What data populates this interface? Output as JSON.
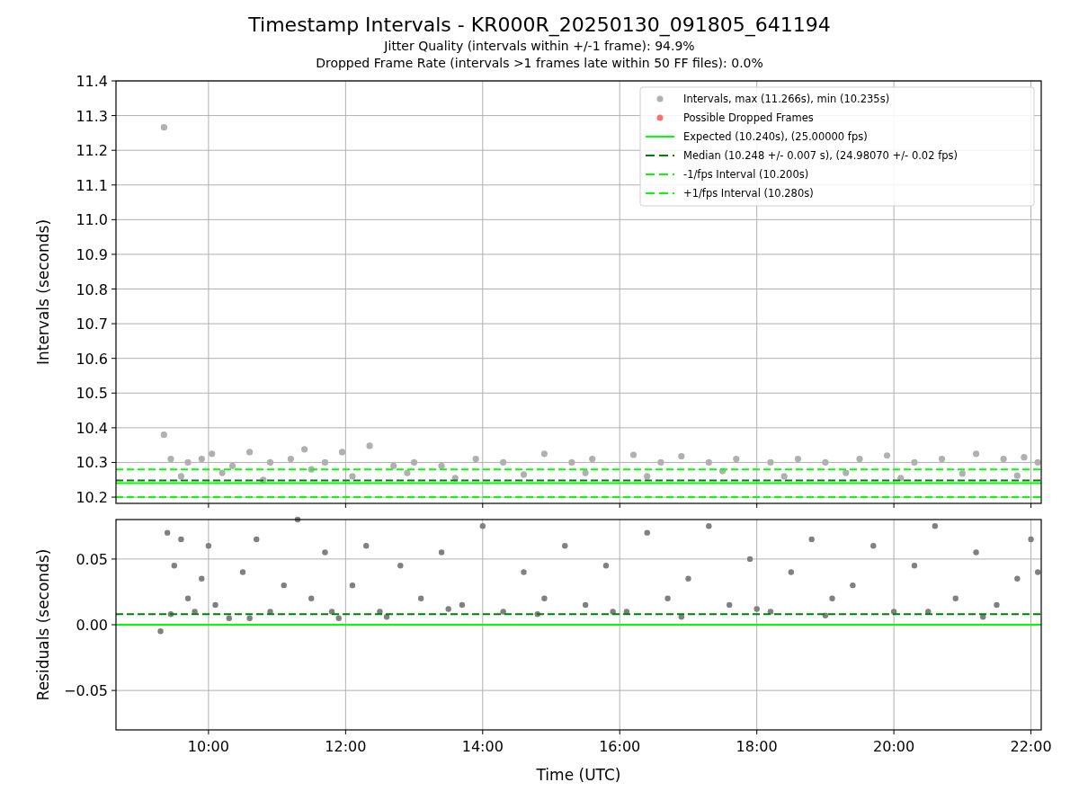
{
  "figure": {
    "title": "Timestamp Intervals - KR000R_20250130_091805_641194",
    "subtitles": [
      "Jitter Quality (intervals within +/-1 frame): 94.9%",
      "Dropped Frame Rate (intervals >1 frames late within 50 FF files): 0.0%"
    ]
  },
  "panels": [
    {
      "chart_data": {
        "type": "scatter",
        "legend": "upper right",
        "ylabel": "Intervals (seconds)",
        "xlim": [
          8.65,
          22.15
        ],
        "ylim": [
          10.182,
          11.4
        ],
        "yticks": [
          {
            "value": 10.2,
            "label": "10.2"
          },
          {
            "value": 10.3,
            "label": "10.3"
          },
          {
            "value": 10.4,
            "label": "10.4"
          },
          {
            "value": 10.5,
            "label": "10.5"
          },
          {
            "value": 10.6,
            "label": "10.6"
          },
          {
            "value": 10.7,
            "label": "10.7"
          },
          {
            "value": 10.8,
            "label": "10.8"
          },
          {
            "value": 10.9,
            "label": "10.9"
          },
          {
            "value": 11.0,
            "label": "11.0"
          },
          {
            "value": 11.1,
            "label": "11.1"
          },
          {
            "value": 11.2,
            "label": "11.2"
          },
          {
            "value": 11.3,
            "label": "11.3"
          },
          {
            "value": 11.4,
            "label": "11.4"
          }
        ],
        "series": [
          {
            "name": "Intervals, max (11.266s), min (10.235s)",
            "type": "scatter",
            "color": "#b0b0b0",
            "x": [
              9.35,
              9.35,
              9.45,
              9.7,
              9.9,
              10.05,
              10.35,
              10.6,
              10.9,
              11.2,
              11.4,
              11.7,
              11.95,
              12.35,
              12.7,
              13.0,
              13.4,
              13.9,
              14.3,
              14.9,
              15.3,
              15.6,
              16.2,
              16.6,
              16.9,
              17.3,
              17.7,
              18.2,
              18.6,
              19.0,
              19.5,
              19.9,
              20.3,
              20.7,
              21.2,
              21.6,
              21.9,
              22.1,
              9.6,
              10.2,
              10.8,
              11.5,
              12.1,
              12.9,
              13.6,
              14.6,
              15.5,
              16.4,
              17.5,
              18.4,
              19.3,
              20.1,
              21.0,
              21.8
            ],
            "values": [
              11.266,
              10.38,
              10.31,
              10.3,
              10.31,
              10.325,
              10.29,
              10.33,
              10.3,
              10.31,
              10.338,
              10.3,
              10.33,
              10.348,
              10.29,
              10.3,
              10.29,
              10.31,
              10.3,
              10.325,
              10.3,
              10.31,
              10.322,
              10.3,
              10.318,
              10.3,
              10.31,
              10.3,
              10.31,
              10.3,
              10.31,
              10.32,
              10.3,
              10.31,
              10.325,
              10.31,
              10.315,
              10.3,
              10.26,
              10.27,
              10.25,
              10.28,
              10.26,
              10.27,
              10.255,
              10.265,
              10.27,
              10.26,
              10.275,
              10.26,
              10.27,
              10.255,
              10.268,
              10.262
            ]
          },
          {
            "name": "Possible Dropped Frames",
            "type": "scatter",
            "color": "#ff7070"
          },
          {
            "name": "Expected (10.240s), (25.00000 fps)",
            "type": "line",
            "line_style": "solid",
            "color": "#00ff00",
            "x": [
              8.65,
              22.15
            ],
            "values": [
              10.24,
              10.24
            ]
          },
          {
            "name": "Median (10.248 +/- 0.007 s), (24.98070 +/- 0.02 fps)",
            "type": "line",
            "line_style": "dashed",
            "color": "#008000",
            "x": [
              8.65,
              22.15
            ],
            "values": [
              10.248,
              10.248
            ]
          },
          {
            "name": "-1/fps Interval (10.200s)",
            "type": "line",
            "line_style": "dashed",
            "color": "#00ff00",
            "x": [
              8.65,
              22.15
            ],
            "values": [
              10.2,
              10.2
            ]
          },
          {
            "name": "+1/fps Interval (10.280s)",
            "type": "line",
            "line_style": "dashed",
            "color": "#00ff00",
            "x": [
              8.65,
              22.15
            ],
            "values": [
              10.28,
              10.28
            ]
          }
        ],
        "grid": true
      }
    },
    {
      "chart_data": {
        "type": "scatter",
        "xlabel": "Time (UTC)",
        "ylabel": "Residuals (seconds)",
        "xlim": [
          8.65,
          22.15
        ],
        "ylim": [
          -0.08,
          0.08
        ],
        "xticks": [
          {
            "value": 10,
            "label": "10:00"
          },
          {
            "value": 12,
            "label": "12:00"
          },
          {
            "value": 14,
            "label": "14:00"
          },
          {
            "value": 16,
            "label": "16:00"
          },
          {
            "value": 18,
            "label": "18:00"
          },
          {
            "value": 20,
            "label": "20:00"
          },
          {
            "value": 22,
            "label": "22:00"
          }
        ],
        "yticks": [
          {
            "value": -0.05,
            "label": "−0.05"
          },
          {
            "value": 0,
            "label": "0.00"
          },
          {
            "value": 0.05,
            "label": "0.05"
          }
        ],
        "series": [
          {
            "type": "scatter",
            "color": "#808080",
            "x": [
              9.3,
              9.4,
              9.5,
              9.6,
              9.7,
              9.8,
              9.9,
              10.0,
              10.1,
              10.3,
              10.5,
              10.7,
              10.9,
              11.1,
              11.3,
              11.5,
              11.7,
              11.9,
              12.1,
              12.3,
              12.5,
              12.8,
              13.1,
              13.4,
              13.7,
              14.0,
              14.3,
              14.6,
              14.9,
              15.2,
              15.5,
              15.8,
              16.1,
              16.4,
              16.7,
              17.0,
              17.3,
              17.6,
              17.9,
              18.2,
              18.5,
              18.8,
              19.1,
              19.4,
              19.7,
              20.0,
              20.3,
              20.6,
              20.9,
              21.2,
              21.5,
              21.8,
              22.0,
              9.45,
              10.6,
              11.8,
              12.6,
              13.5,
              14.8,
              15.9,
              16.9,
              18.0,
              19.0,
              20.5,
              21.3,
              22.1
            ],
            "values": [
              -0.005,
              0.07,
              0.045,
              0.065,
              0.02,
              0.01,
              0.035,
              0.06,
              0.015,
              0.005,
              0.04,
              0.065,
              0.01,
              0.03,
              0.08,
              0.02,
              0.055,
              0.005,
              0.03,
              0.06,
              0.01,
              0.045,
              0.02,
              0.055,
              0.015,
              0.075,
              0.01,
              0.04,
              0.02,
              0.06,
              0.015,
              0.045,
              0.01,
              0.07,
              0.02,
              0.035,
              0.075,
              0.015,
              0.05,
              0.01,
              0.04,
              0.065,
              0.02,
              0.03,
              0.06,
              0.01,
              0.045,
              0.075,
              0.02,
              0.055,
              0.015,
              0.035,
              0.065,
              0.008,
              0.005,
              0.01,
              0.006,
              0.012,
              0.008,
              0.01,
              0.006,
              0.012,
              0.007,
              0.01,
              0.006,
              0.04
            ]
          },
          {
            "type": "line",
            "line_style": "dashed",
            "color": "#008000",
            "x": [
              8.65,
              22.15
            ],
            "values": [
              0.008,
              0.008
            ]
          },
          {
            "type": "line",
            "line_style": "solid",
            "color": "#00ff00",
            "x": [
              8.65,
              22.15
            ],
            "values": [
              0,
              0
            ]
          }
        ],
        "grid": true
      }
    }
  ]
}
